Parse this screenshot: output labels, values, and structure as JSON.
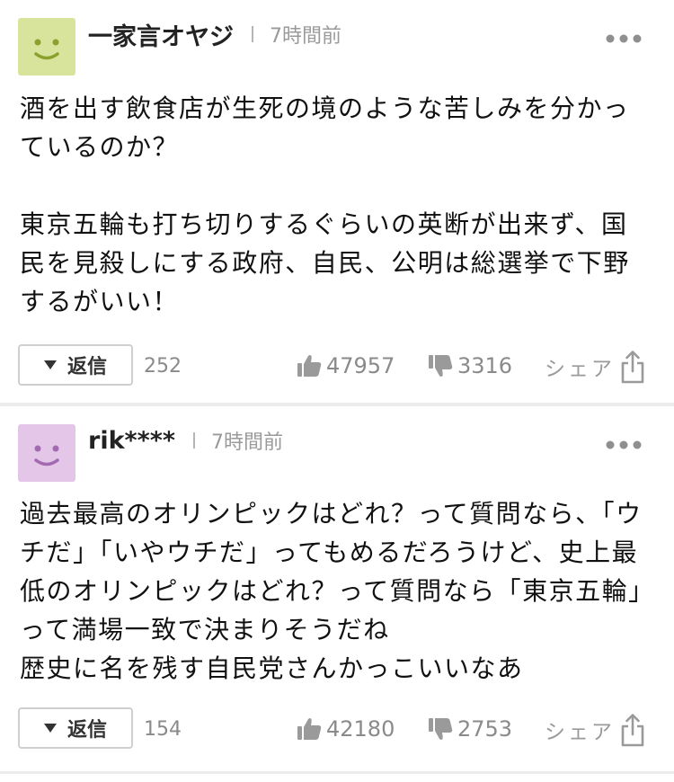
{
  "comments": [
    {
      "username": "一家言オヤジ",
      "time": "7時間前",
      "avatar_color": "#d8e39b",
      "avatar_face_color": "#8aa12e",
      "text": "酒を出す飲食店が生死の境のような苦しみを分かっているのか？\n\n東京五輪も打ち切りするぐらいの英断が出来ず、国民を見殺しにする政府、自民、公明は総選挙で下野するがいい！",
      "reply_label": "返信",
      "reply_count": "252",
      "likes": "47957",
      "dislikes": "3316",
      "share_label": "シェア"
    },
    {
      "username": "rik****",
      "time": "7時間前",
      "avatar_color": "#e3c6e8",
      "avatar_face_color": "#a46ab1",
      "text": "過去最高のオリンピックはどれ？って質問なら、「ウチだ」「いやウチだ」ってもめるだろうけど、史上最低のオリンピックはどれ？って質問なら「東京五輪」って満場一致で決まりそうだね\n歴史に名を残す自民党さんかっこいいなあ",
      "reply_label": "返信",
      "reply_count": "154",
      "likes": "42180",
      "dislikes": "2753",
      "share_label": "シェア"
    }
  ],
  "icons": {
    "more": "more-dots-icon",
    "like": "thumbs-up-icon",
    "dislike": "thumbs-down-icon",
    "share": "share-icon",
    "reply_toggle": "triangle-down-icon"
  },
  "colors": {
    "icon_gray": "#9a9a9a",
    "separator": "#ececec"
  }
}
